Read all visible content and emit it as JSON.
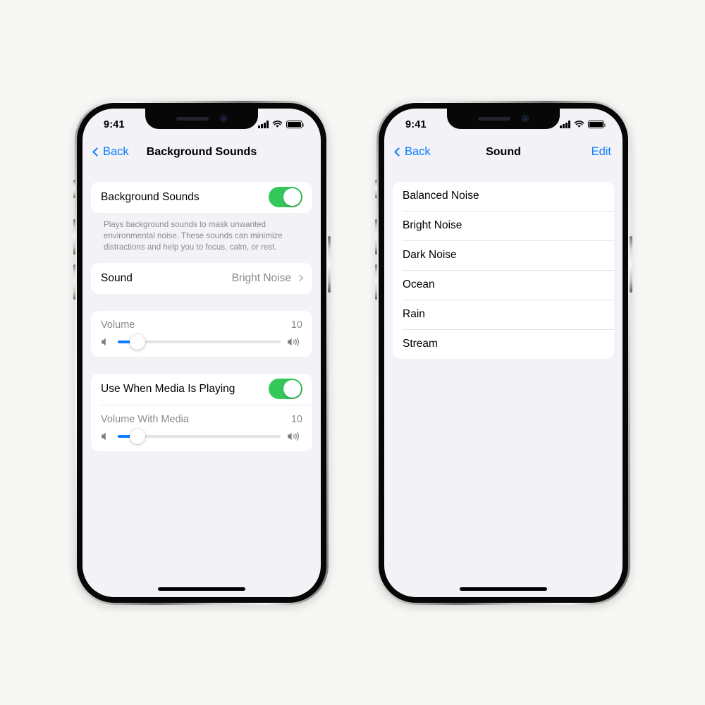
{
  "canvas": {
    "background_color": "#F7F7F5",
    "accent_blue": "#0A7CFF",
    "accent_green": "#34C759",
    "screen_background": "#F2F2F7",
    "card_background": "#FFFFFF"
  },
  "phone_left": {
    "status_bar": {
      "time": "9:41",
      "signal_icon": "cellular-signal-icon",
      "wifi_icon": "wifi-icon",
      "battery_icon": "battery-full-icon"
    },
    "nav": {
      "back_label": "Back",
      "title": "Background Sounds"
    },
    "toggle_row": {
      "label": "Background Sounds",
      "state": "on"
    },
    "footnote": "Plays background sounds to mask unwanted environmental noise. These sounds can minimize distractions and help you to focus, calm, or rest.",
    "sound_row": {
      "label": "Sound",
      "value": "Bright Noise"
    },
    "volume_slider": {
      "label": "Volume",
      "value": "10",
      "percent": 12,
      "min_icon": "speaker-low-icon",
      "max_icon": "speaker-high-icon"
    },
    "media_toggle_row": {
      "label": "Use When Media Is Playing",
      "state": "on"
    },
    "media_volume_slider": {
      "label": "Volume With Media",
      "value": "10",
      "percent": 12,
      "min_icon": "speaker-low-icon",
      "max_icon": "speaker-high-icon"
    }
  },
  "phone_right": {
    "status_bar": {
      "time": "9:41",
      "signal_icon": "cellular-signal-icon",
      "wifi_icon": "wifi-icon",
      "battery_icon": "battery-full-icon"
    },
    "nav": {
      "back_label": "Back",
      "title": "Sound",
      "edit_label": "Edit"
    },
    "sound_list": [
      {
        "label": "Balanced Noise"
      },
      {
        "label": "Bright Noise"
      },
      {
        "label": "Dark Noise"
      },
      {
        "label": "Ocean"
      },
      {
        "label": "Rain"
      },
      {
        "label": "Stream"
      }
    ]
  }
}
